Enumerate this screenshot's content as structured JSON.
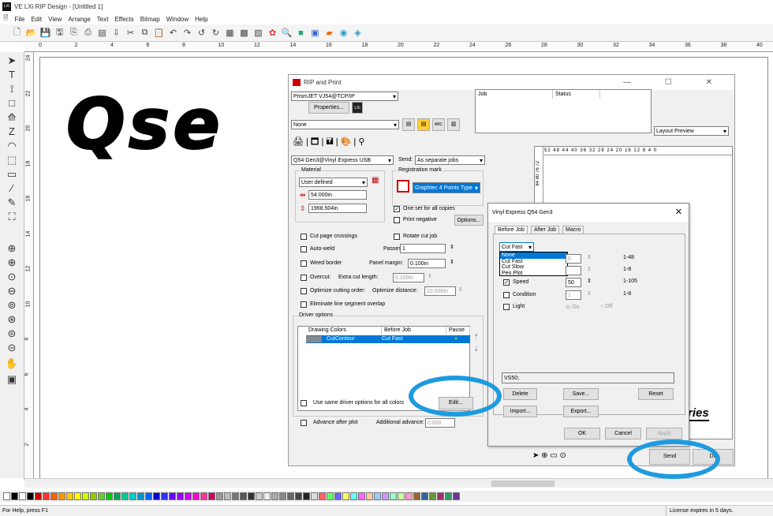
{
  "window": {
    "title": "VE LXi RIP Design - [Untitled 1]",
    "app_icon_text": "LXi"
  },
  "menu": [
    "File",
    "Edit",
    "View",
    "Arrange",
    "Text",
    "Effects",
    "Bitmap",
    "Window",
    "Help"
  ],
  "ruler_labels": [
    "0",
    "2",
    "4",
    "6",
    "8",
    "10",
    "12",
    "14",
    "16",
    "18",
    "20",
    "22",
    "24",
    "26",
    "28",
    "30",
    "32",
    "34",
    "36",
    "38",
    "40"
  ],
  "vruler_labels": [
    "24",
    "22",
    "20",
    "18",
    "16",
    "14",
    "12",
    "10",
    "8",
    "6",
    "4",
    "2",
    "0"
  ],
  "canvas": {
    "artwork_text": "Qse"
  },
  "status": {
    "help": "For Help, press F1",
    "license": "License expires in 5 days."
  },
  "rip": {
    "title": "RIP and Print",
    "printer": "PrismJET VJ54@TCP/IP",
    "properties_label": "Properties...",
    "lxi_badge": "LXi",
    "profile": "None",
    "job_col": "Job",
    "status_col": "Status",
    "layout_preview": "Layout Preview",
    "cutter": "Q54 Gen3@Vinyl Express USB",
    "send_label": "Send:",
    "send_mode": "As separate jobs",
    "material_group": "Material",
    "material": "User defined",
    "width": "54.000in",
    "length": "1968.504in",
    "regmark_group": "Registration mark",
    "regmark": "Graphtec 4 Points Type",
    "one_set": "One set for all copies",
    "print_negative": "Print negative",
    "options_label": "Options...",
    "cut_page_crossings": "Cut page crossings",
    "rotate_cut_job": "Rotate cut job",
    "auto_weld": "Auto-weld",
    "passes_label": "Passes:",
    "passes": "1",
    "weed_border": "Weed border",
    "panel_margin_label": "Panel margin:",
    "panel_margin": "0.100in",
    "overcut": "Overcut:",
    "extra_cut_label": "Extra cut length:",
    "extra_cut": "0.100in",
    "optimize_order": "Optimize cutting order:",
    "optimize_distance_label": "Optimize distance:",
    "optimize_distance": "10.000in",
    "eliminate_overlap": "Eliminate line segment overlap",
    "driver_group": "Driver options",
    "drv_cols": [
      "Drawing Colors",
      "Before Job",
      "Pause"
    ],
    "drv_row": {
      "color": "CutContour",
      "before": "Cut Fast"
    },
    "same_driver": "Use same driver options for all colors",
    "edit_label": "Edit...",
    "advance_after_plot": "Advance after plot",
    "additional_advance_label": "Additional advance:",
    "additional_advance": "0.000",
    "send_button": "Send",
    "done_button": "Do",
    "preview_ruler": "52  48  44  40  36  32  28  24  20  16  12   8   4   0",
    "preview_vruler": "84  80  76  72",
    "preview_art": "ries"
  },
  "vinyl": {
    "title": "Vinyl Express Q54 Gen3",
    "tabs": [
      "Before Job",
      "After Job",
      "Macro"
    ],
    "mode": "Cut Fast",
    "options": [
      "None",
      "Cut Fast",
      "Cut Slow",
      "Pen Plot"
    ],
    "selected_option": "None",
    "ranges": [
      "1-48",
      "1-8",
      "1-105",
      "1-8"
    ],
    "speed_label": "Speed",
    "speed_value": "50",
    "condition_label": "Condition",
    "condition_value": "1",
    "light_label": "Light",
    "on_label": "On",
    "off_label": "Off",
    "command": "VS50;",
    "delete_label": "Delete",
    "save_label": "Save...",
    "reset_label": "Reset",
    "import_label": "Import...",
    "export_label": "Export...",
    "ok_label": "OK",
    "cancel_label": "Cancel",
    "apply_label": "Apply"
  },
  "colors": {
    "accent": "#0078d7",
    "ring": "#1e9be0"
  }
}
